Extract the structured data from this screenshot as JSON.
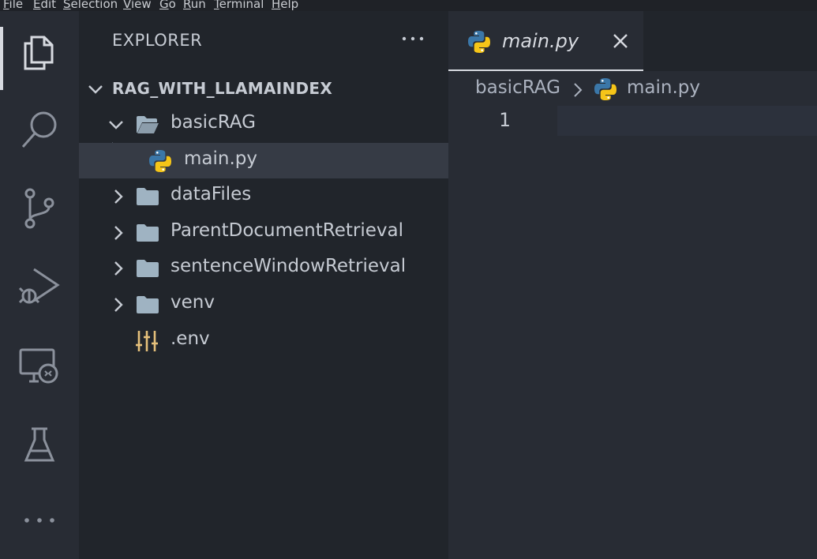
{
  "menu": [
    {
      "label": "File",
      "underline": "F",
      "rest": "ile"
    },
    {
      "label": "Edit",
      "underline": "E",
      "rest": "dit"
    },
    {
      "label": "Selection",
      "underline": "S",
      "rest": "election"
    },
    {
      "label": "View",
      "underline": "V",
      "rest": "iew"
    },
    {
      "label": "Go",
      "underline": "G",
      "rest": "o"
    },
    {
      "label": "Run",
      "underline": "R",
      "rest": "un"
    },
    {
      "label": "Terminal",
      "underline": "T",
      "rest": "erminal"
    },
    {
      "label": "Help",
      "underline": "H",
      "rest": "elp"
    }
  ],
  "activity_bar": {
    "items": [
      "files-icon",
      "search-icon",
      "source-control-icon",
      "run-debug-icon",
      "remote-explorer-icon",
      "testing-icon",
      "more-icon"
    ],
    "active": "files-icon"
  },
  "sidebar": {
    "title": "EXPLORER",
    "more_actions": "···",
    "workspace": "RAG_WITH_LLAMAINDEX",
    "tree": [
      {
        "label": "basicRAG",
        "type": "folder",
        "expanded": true
      },
      {
        "label": "main.py",
        "type": "python-file",
        "selected": true
      },
      {
        "label": "dataFiles",
        "type": "folder",
        "expanded": false
      },
      {
        "label": "ParentDocumentRetrieval",
        "type": "folder",
        "expanded": false
      },
      {
        "label": "sentenceWindowRetrieval",
        "type": "folder",
        "expanded": false
      },
      {
        "label": "venv",
        "type": "folder",
        "expanded": false
      },
      {
        "label": ".env",
        "type": "env-file"
      }
    ]
  },
  "editor": {
    "tab": {
      "label": "main.py",
      "close": "×"
    },
    "breadcrumb": {
      "folder": "basicRAG",
      "file": "main.py"
    },
    "line_numbers": [
      "1"
    ]
  },
  "colors": {
    "accent": "#d7dae0",
    "folder": "#9fb3c2",
    "python_blue": "#3b77a8",
    "python_yellow": "#f5c518",
    "env_yellow": "#e5c07b"
  }
}
